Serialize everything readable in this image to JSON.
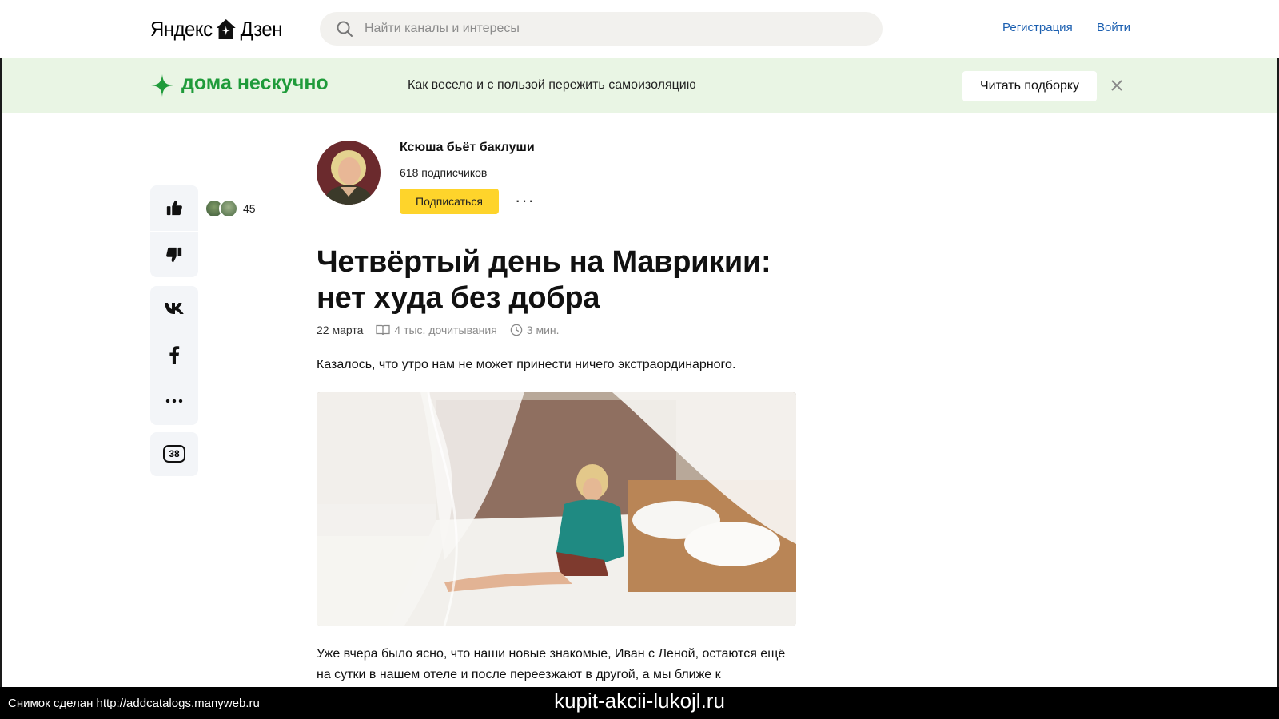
{
  "header": {
    "logo_left": "Яндекс",
    "logo_right": "Дзен",
    "search_placeholder": "Найти каналы и интересы",
    "register_label": "Регистрация",
    "login_label": "Войти"
  },
  "banner": {
    "title": "дома нескучно",
    "text": "Как весело и с пользой пережить самоизоляцию",
    "button_label": "Читать подборку",
    "accent_color": "#1f9b3a",
    "background_color": "#e9f5e4"
  },
  "rail": {
    "likes_count": "45",
    "comments_count": "38",
    "icons": [
      "thumb-up-icon",
      "thumb-down-icon",
      "vk-icon",
      "facebook-icon",
      "more-icon",
      "comments-icon"
    ]
  },
  "channel": {
    "name": "Ксюша бьёт баклуши",
    "subscribers": "618 подписчиков",
    "subscribe_label": "Подписаться",
    "subscribe_color": "#fed42b"
  },
  "article": {
    "title": "Четвёртый день на Маврикии: нет худа без добра",
    "date": "22 марта",
    "reads": "4 тыс. дочитывания",
    "read_time": "3 мин.",
    "lead": "Казалось, что утро нам не может принести ничего экстраординарного.",
    "paragraph": "Уже вчера было ясно, что наши новые знакомые, Иван с Леной, остаются ещё на сутки в нашем отеле и после переезжают в другой, а мы ближе к"
  },
  "footer": {
    "snapshot_note": "Снимок сделан http://addcatalogs.manyweb.ru",
    "watermark": "kupit-akcii-lukojl.ru"
  }
}
